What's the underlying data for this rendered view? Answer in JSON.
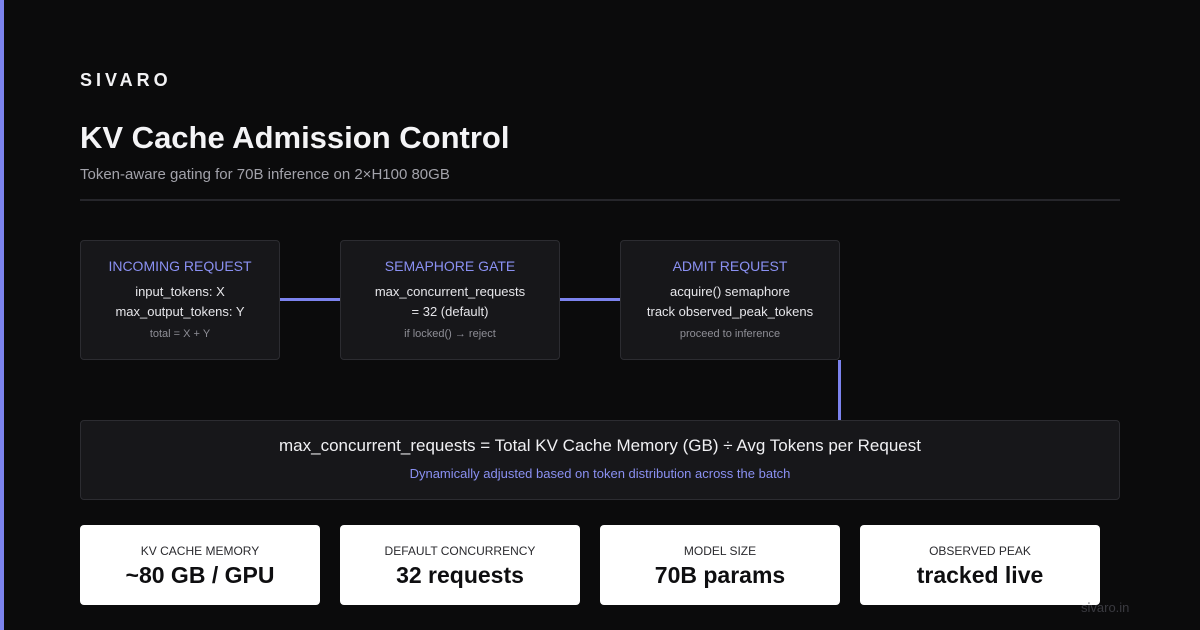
{
  "brand": "SIVARO",
  "title": "KV Cache Admission Control",
  "subtitle": "Token-aware gating for 70B inference on 2×H100 80GB",
  "colors": {
    "accent": "#7c83ee",
    "background": "#0b0b0c",
    "card": "#17171a"
  },
  "flow": [
    {
      "head": "INCOMING REQUEST",
      "lines": [
        "input_tokens: X",
        "max_output_tokens: Y"
      ],
      "note": "total = X + Y"
    },
    {
      "head": "SEMAPHORE GATE",
      "lines": [
        "max_concurrent_requests",
        "= 32 (default)"
      ],
      "note": "if locked() → reject"
    },
    {
      "head": "ADMIT REQUEST",
      "lines": [
        "acquire() semaphore",
        "track observed_peak_tokens"
      ],
      "note": "proceed to inference"
    }
  ],
  "formula": {
    "equation": "max_concurrent_requests = Total KV Cache Memory (GB) ÷ Avg Tokens per Request",
    "note": "Dynamically adjusted based on token distribution across the batch"
  },
  "stats": [
    {
      "label": "KV CACHE MEMORY",
      "value": "~80 GB / GPU"
    },
    {
      "label": "DEFAULT CONCURRENCY",
      "value": "32 requests"
    },
    {
      "label": "MODEL SIZE",
      "value": "70B params"
    },
    {
      "label": "OBSERVED PEAK",
      "value": "tracked live"
    }
  ],
  "footer": "sivaro.in"
}
